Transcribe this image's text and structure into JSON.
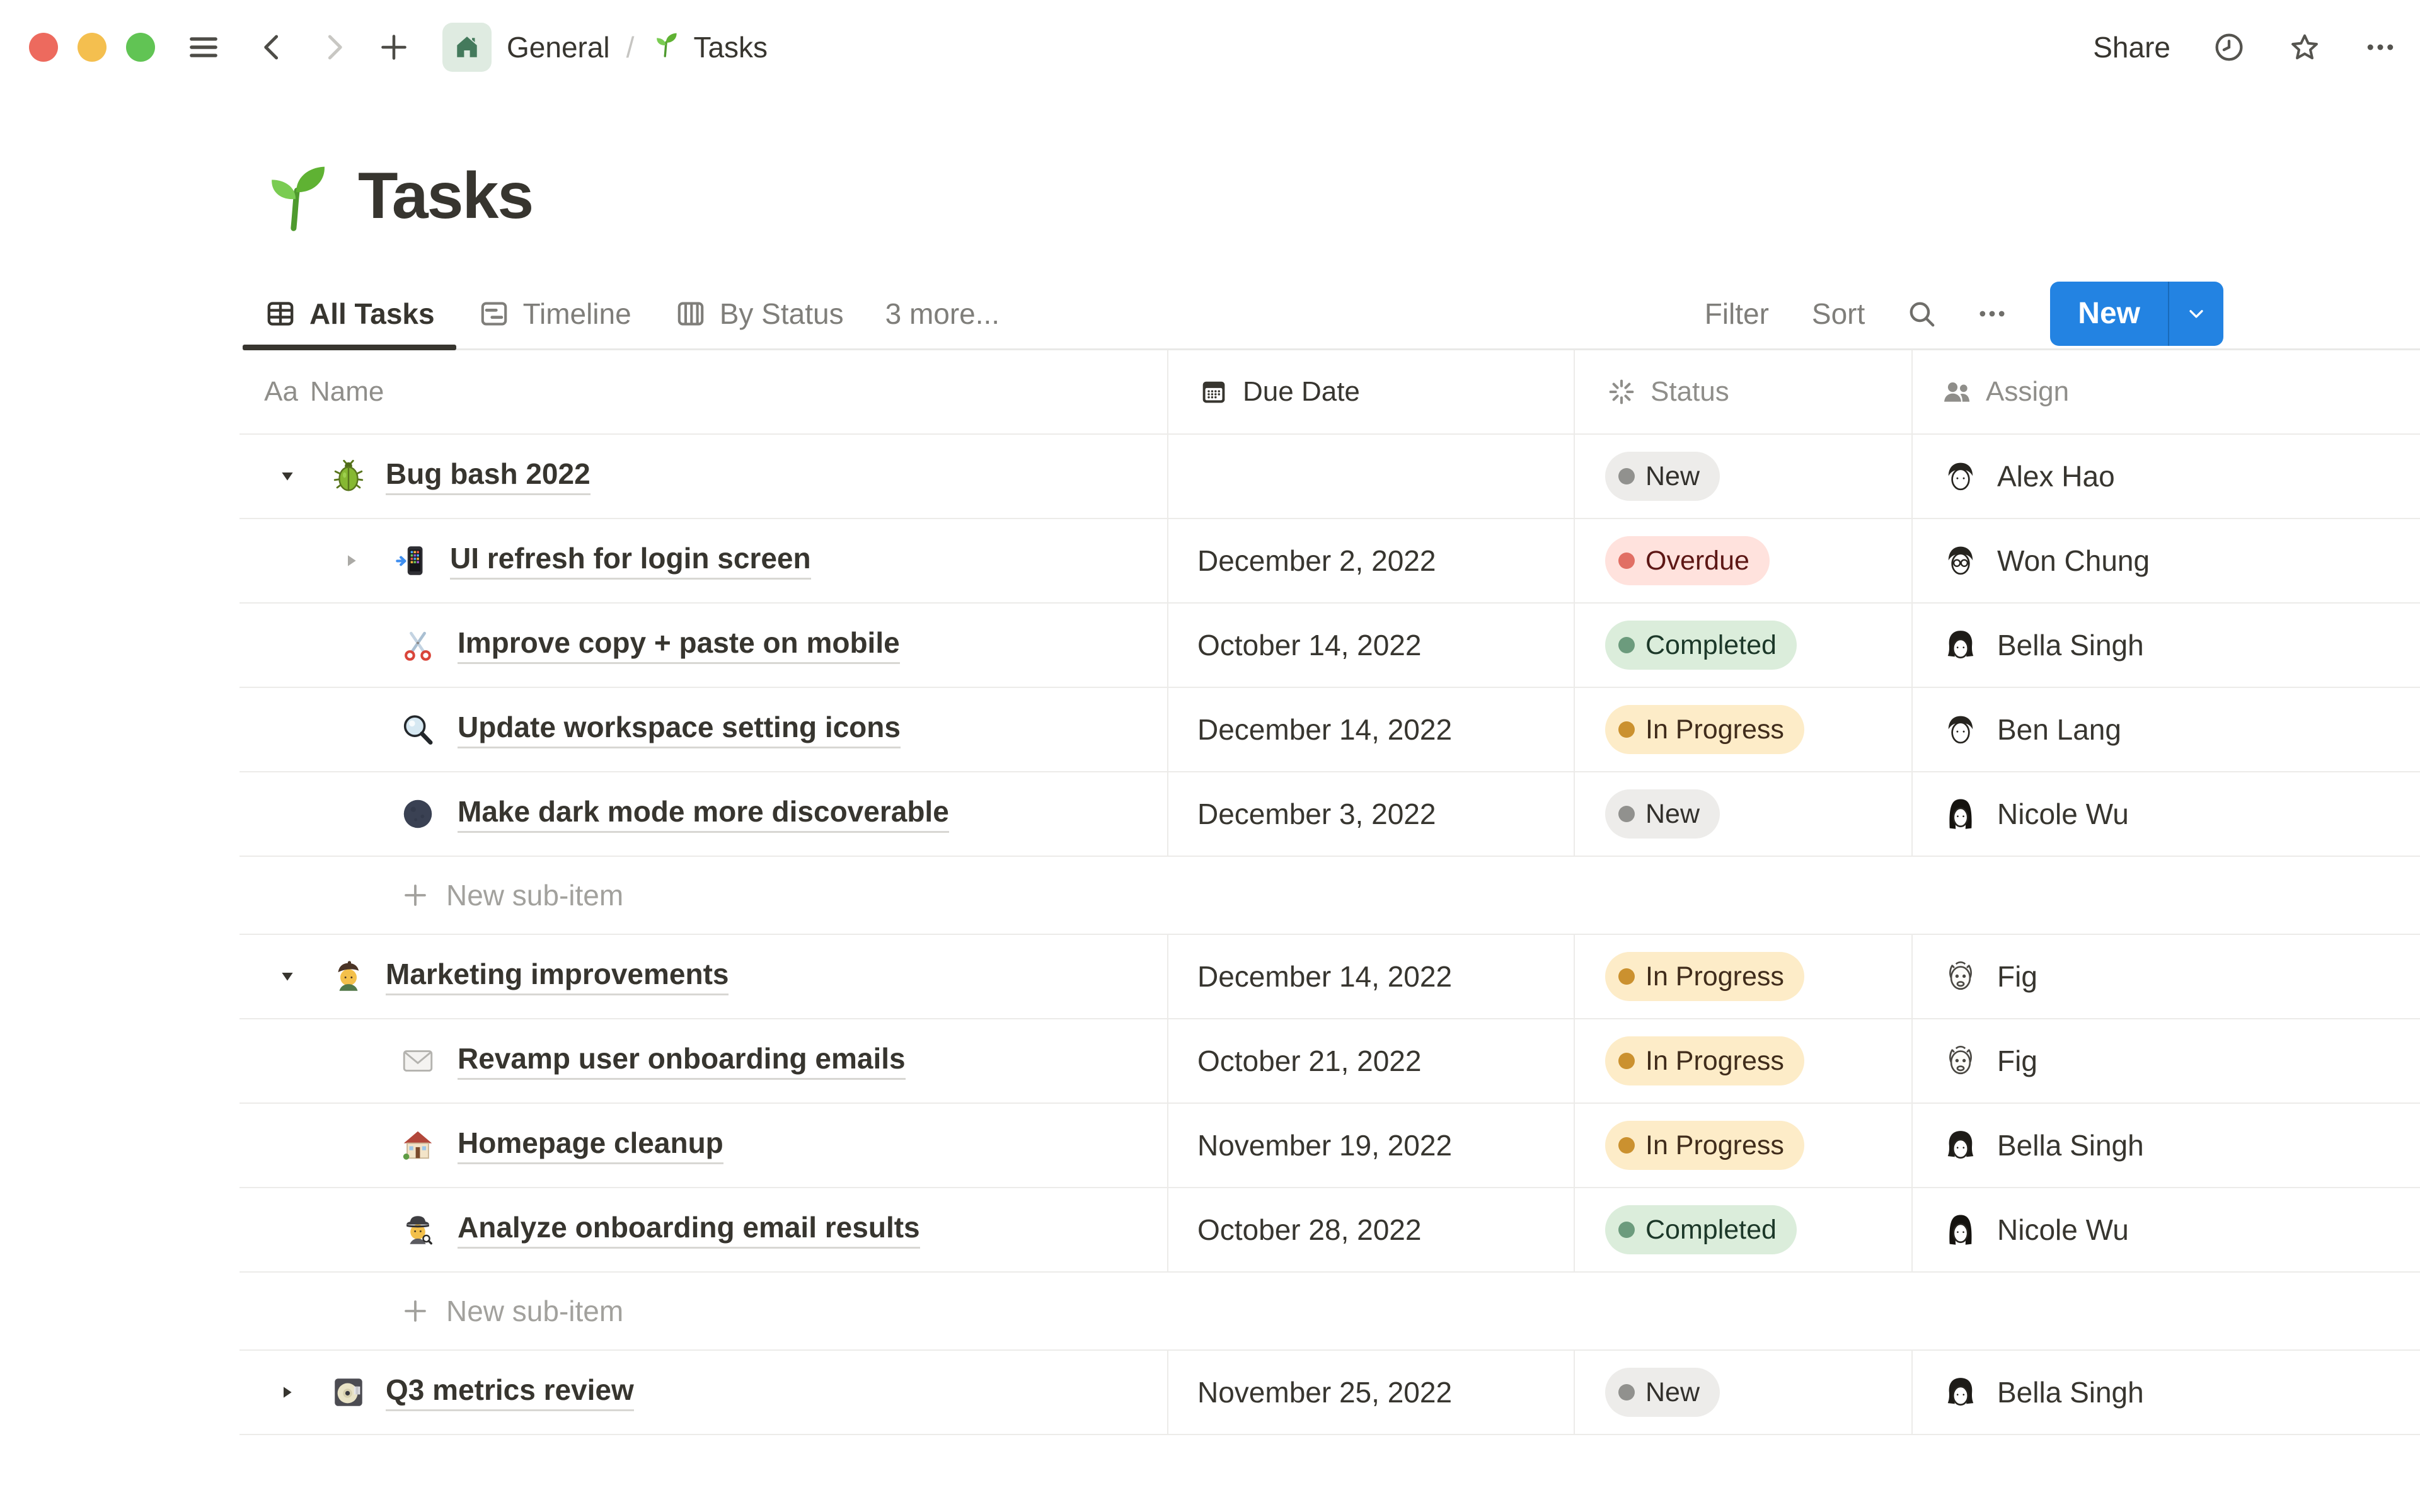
{
  "topbar": {
    "window_controls": [
      "close",
      "minimize",
      "zoom"
    ],
    "breadcrumb": {
      "teamspace": {
        "label": "General",
        "icon": "home-teamspace-icon",
        "icon_bg": "#DFEBE1"
      },
      "separator": "/",
      "page": {
        "label": "Tasks",
        "icon": "seedling-emoji"
      }
    },
    "share_label": "Share"
  },
  "page": {
    "icon": "seedling-emoji",
    "title": "Tasks"
  },
  "views": {
    "tabs": [
      {
        "id": "all-tasks",
        "label": "All Tasks",
        "icon": "table-view-icon",
        "active": true
      },
      {
        "id": "timeline",
        "label": "Timeline",
        "icon": "timeline-view-icon",
        "active": false
      },
      {
        "id": "by-status",
        "label": "By Status",
        "icon": "board-view-icon",
        "active": false
      }
    ],
    "more_label": "3 more...",
    "toolbar": {
      "filter_label": "Filter",
      "sort_label": "Sort",
      "new_button_label": "New"
    }
  },
  "table": {
    "columns": [
      {
        "id": "name",
        "label": "Name",
        "icon": "text-property-icon"
      },
      {
        "id": "due",
        "label": "Due Date",
        "icon": "calendar-icon"
      },
      {
        "id": "status",
        "label": "Status",
        "icon": "status-spinner-icon"
      },
      {
        "id": "assign",
        "label": "Assign",
        "icon": "people-icon"
      }
    ],
    "new_sub_item_label": "New sub-item",
    "status_styles": {
      "New": {
        "bg": "#EDECEA",
        "dot": "#91918E",
        "text": "#32302C"
      },
      "Overdue": {
        "bg": "#FFE2DD",
        "dot": "#E16F64",
        "text": "#5D1715"
      },
      "Completed": {
        "bg": "#DBEDDB",
        "dot": "#6C9B7D",
        "text": "#1C3829"
      },
      "In Progress": {
        "bg": "#FDECC8",
        "dot": "#CB912F",
        "text": "#402C1B"
      }
    },
    "rows": [
      {
        "type": "group",
        "toggle": "expanded",
        "toggle_tone": "dark",
        "emoji": "beetle",
        "name": "Bug bash 2022",
        "due": "",
        "status": "New",
        "assignee": {
          "name": "Alex Hao",
          "avatar": "man-short"
        }
      },
      {
        "type": "subtask",
        "toggle": "collapsed",
        "toggle_tone": "gray",
        "emoji": "mobile-phone-arrow",
        "name": "UI refresh for login screen",
        "due": "December 2, 2022",
        "status": "Overdue",
        "assignee": {
          "name": "Won Chung",
          "avatar": "man-glasses"
        }
      },
      {
        "type": "subtask",
        "emoji": "scissors",
        "name": "Improve copy + paste on mobile",
        "due": "October 14, 2022",
        "status": "Completed",
        "assignee": {
          "name": "Bella Singh",
          "avatar": "woman-bob"
        }
      },
      {
        "type": "subtask",
        "emoji": "magnifying-glass",
        "name": "Update workspace setting icons",
        "due": "December 14, 2022",
        "status": "In Progress",
        "assignee": {
          "name": "Ben Lang",
          "avatar": "man-short"
        }
      },
      {
        "type": "subtask",
        "emoji": "new-moon",
        "name": "Make dark mode more discoverable",
        "due": "December 3, 2022",
        "status": "New",
        "assignee": {
          "name": "Nicole Wu",
          "avatar": "woman-long"
        }
      },
      {
        "type": "new-sub-item"
      },
      {
        "type": "group",
        "toggle": "expanded",
        "toggle_tone": "dark",
        "emoji": "artist",
        "name": "Marketing improvements",
        "due": "December 14, 2022",
        "status": "In Progress",
        "assignee": {
          "name": "Fig",
          "avatar": "dog"
        }
      },
      {
        "type": "subtask",
        "emoji": "envelope",
        "name": "Revamp user onboarding emails",
        "due": "October 21, 2022",
        "status": "In Progress",
        "assignee": {
          "name": "Fig",
          "avatar": "dog"
        }
      },
      {
        "type": "subtask",
        "emoji": "house-garden",
        "name": "Homepage cleanup",
        "due": "November 19, 2022",
        "status": "In Progress",
        "assignee": {
          "name": "Bella Singh",
          "avatar": "woman-bob"
        }
      },
      {
        "type": "subtask",
        "emoji": "detective",
        "name": "Analyze onboarding email results",
        "due": "October 28, 2022",
        "status": "Completed",
        "assignee": {
          "name": "Nicole Wu",
          "avatar": "woman-long"
        }
      },
      {
        "type": "new-sub-item"
      },
      {
        "type": "group",
        "toggle": "collapsed",
        "toggle_tone": "dark",
        "emoji": "minidisc",
        "name": "Q3 metrics review",
        "due": "November 25, 2022",
        "status": "New",
        "assignee": {
          "name": "Bella Singh",
          "avatar": "woman-bob"
        }
      }
    ]
  }
}
